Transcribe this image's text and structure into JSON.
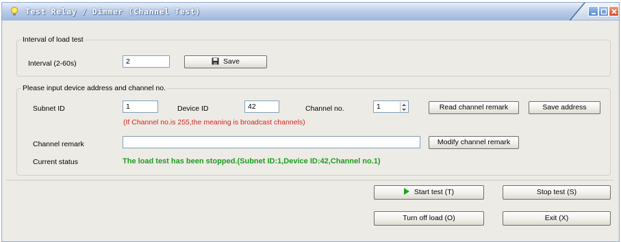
{
  "window": {
    "title": "Test Relay / Dimmer (Channel Test)"
  },
  "interval_group": {
    "legend": "Interval of load test",
    "interval_label": "Interval (2-60s)",
    "interval_value": "2",
    "save_label": "Save"
  },
  "address_group": {
    "legend": "Please input device address and channel no.",
    "subnet_label": "Subnet ID",
    "subnet_value": "1",
    "device_label": "Device ID",
    "device_value": "42",
    "channel_label": "Channel no.",
    "channel_value": "1",
    "read_remark_label": "Read channel remark",
    "save_address_label": "Save address",
    "hint": "(If Channel no.is 255,the meaning is broadcast channels)",
    "remark_label": "Channel remark",
    "remark_value": "",
    "modify_remark_label": "Modify channel remark",
    "status_label": "Current status",
    "status_text": "The load test has been stopped.(Subnet ID:1,Device ID:42,Channel no.1)"
  },
  "actions": {
    "start_label": "Start test (T)",
    "stop_label": "Stop test (S)",
    "turn_off_label": "Turn off load (O)",
    "exit_label": "Exit (X)"
  },
  "colors": {
    "status": "#1e9b1e",
    "hint": "#d8241c",
    "window_bg": "#ecebe6"
  },
  "icons": [
    "bulb-icon",
    "floppy-disk-icon",
    "play-icon",
    "minimize-icon",
    "maximize-icon",
    "close-icon"
  ]
}
